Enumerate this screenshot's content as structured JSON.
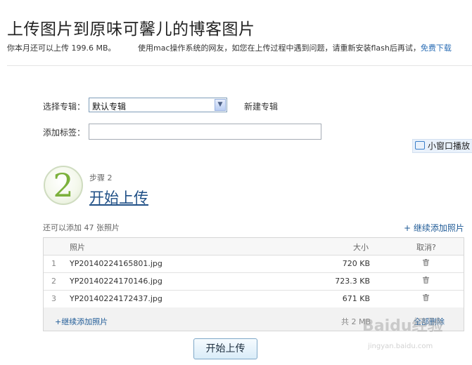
{
  "header": {
    "title": "上传图片到原味可馨儿的博客图片",
    "quota": "你本月还可以上传 199.6 MB。",
    "notice": "使用mac操作系统的网友，如您在上传过程中遇到问题，请重新安装flash后再试，",
    "notice_link": "免费下载"
  },
  "form": {
    "album_label": "选择专辑：",
    "album_value": "默认专辑",
    "new_album": "新建专辑",
    "tags_label": "添加标签：",
    "tags_value": ""
  },
  "popout": {
    "label": "小窗口播放",
    "icon": "tv-icon"
  },
  "step": {
    "number": "2",
    "label": "步骤 2",
    "title": "开始上传"
  },
  "upload": {
    "remaining": "还可以添加 47 张照片",
    "add_more_top": "+ 继续添加照片",
    "columns": {
      "photo": "照片",
      "size": "大小",
      "cancel": "取消?"
    },
    "rows": [
      {
        "index": "1",
        "name": "YP20140224165801.jpg",
        "size": "720 KB"
      },
      {
        "index": "2",
        "name": "YP20140224170146.jpg",
        "size": "723.3 KB"
      },
      {
        "index": "3",
        "name": "YP20140224172437.jpg",
        "size": "671 KB"
      }
    ],
    "add_more_bottom": "+继续添加照片",
    "total": "共 2 MB",
    "delete_all": "全部删除"
  },
  "start_button": "开始上传",
  "watermark": {
    "brand": "Baidu经验",
    "url": "jingyan.baidu.com"
  },
  "colors": {
    "link": "#1e5a96",
    "step_green": "#7cb13c",
    "title_blue": "#1f4f86"
  }
}
